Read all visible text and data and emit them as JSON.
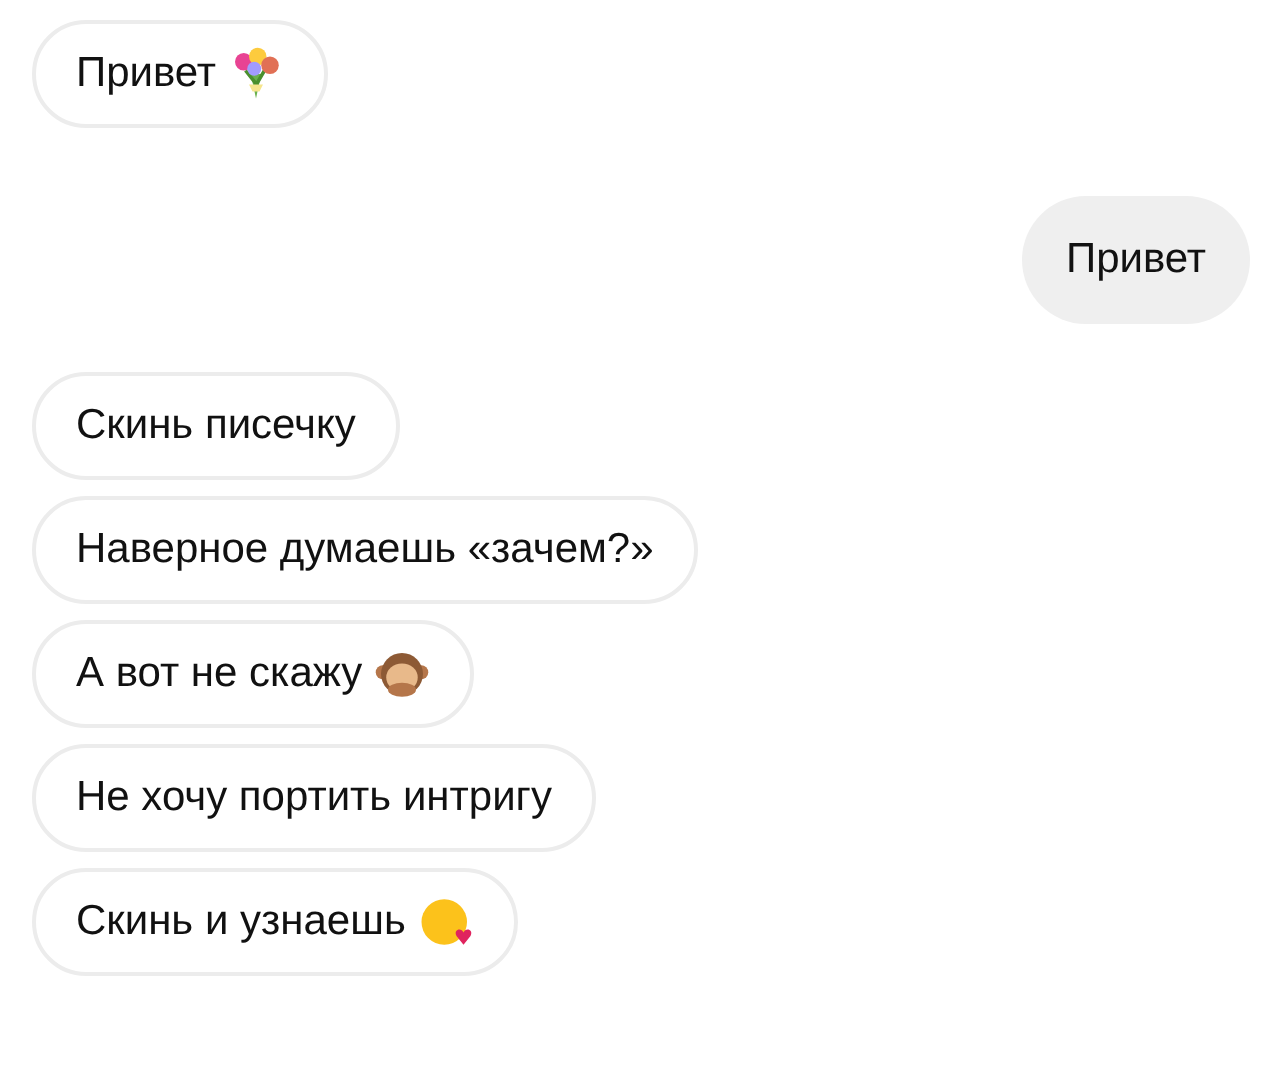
{
  "messages": [
    {
      "kind": "incoming",
      "text": "Привет",
      "icon": {
        "kind": "bouquet"
      }
    },
    {
      "kind": "outgoing",
      "text": "Привет"
    },
    {
      "kind": "incoming",
      "text": "Скинь писечку"
    },
    {
      "kind": "incoming",
      "text": "Наверное думаешь «зачем?»"
    },
    {
      "kind": "incoming",
      "text": "А вот не скажу",
      "icon": {
        "kind": "monkey"
      }
    },
    {
      "kind": "incoming",
      "text": "Не хочу портить интригу"
    },
    {
      "kind": "incoming",
      "text": "Скинь и узнаешь",
      "icon": {
        "kind": "kiss"
      }
    }
  ]
}
